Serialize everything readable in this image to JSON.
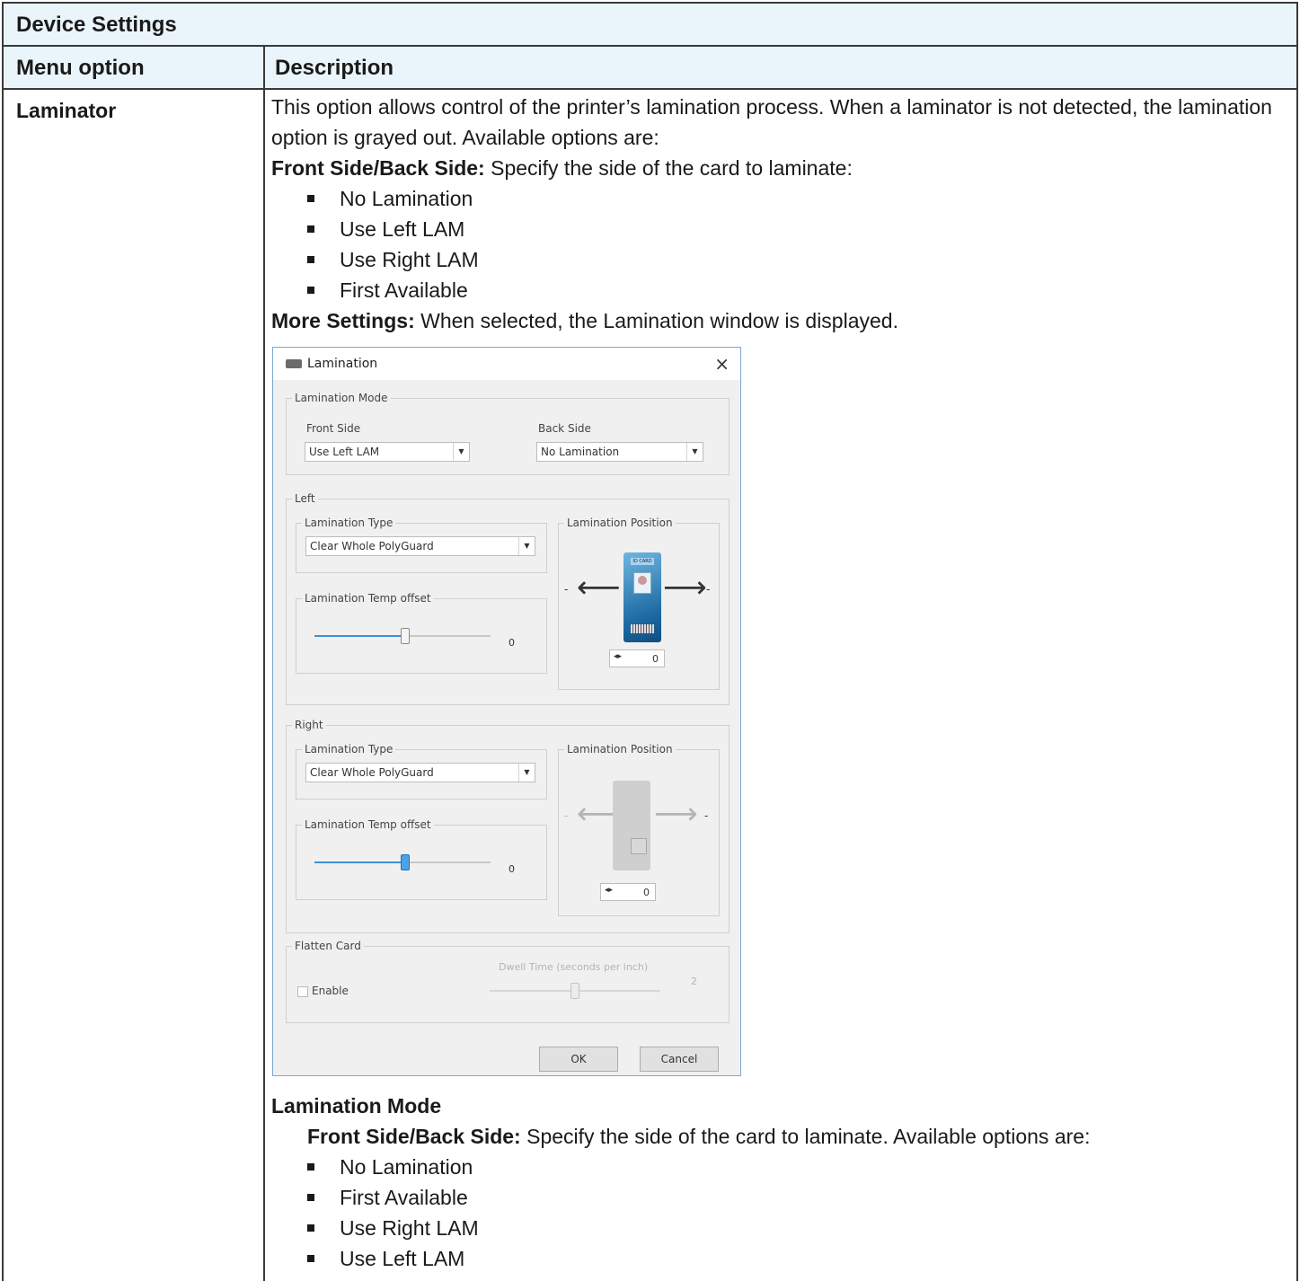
{
  "table": {
    "title": "Device Settings",
    "col_menu": "Menu option",
    "col_desc": "Description"
  },
  "row": {
    "option": "Laminator",
    "intro": "This option allows control of the printer’s lamination process. When a laminator is not detected, the lamination option is grayed out. Available options are:",
    "front_back_label": "Front Side/Back Side:",
    "front_back_text": " Specify the side of the card to laminate:",
    "side_options": [
      "No Lamination",
      "Use Left LAM",
      "Use Right LAM",
      "First Available"
    ],
    "more_label": "More Settings:",
    "more_text": " When selected, the Lamination window is displayed.",
    "mode_heading": "Lamination Mode",
    "mode_label": "Front Side/Back Side:",
    "mode_text": " Specify the side of the card to laminate. Available options are:",
    "mode_options": [
      "No Lamination",
      "First Available",
      "Use Right LAM",
      "Use Left LAM"
    ]
  },
  "dialog": {
    "title": "Lamination",
    "close": "×",
    "mode_group": "Lamination Mode",
    "front_label": "Front Side",
    "front_value": "Use Left LAM",
    "back_label": "Back Side",
    "back_value": "No Lamination",
    "left_group": "Left",
    "right_group": "Right",
    "type_label": "Lamination Type",
    "type_value": "Clear Whole PolyGuard",
    "temp_label": "Lamination Temp offset",
    "temp_value": "0",
    "position_label": "Lamination Position",
    "position_value": "0",
    "card_tag": "ID CARD",
    "flatten_group": "Flatten Card",
    "enable_label": "Enable",
    "dwell_label": "Dwell Time (seconds per inch)",
    "dwell_value": "2",
    "ok": "OK",
    "cancel": "Cancel"
  }
}
